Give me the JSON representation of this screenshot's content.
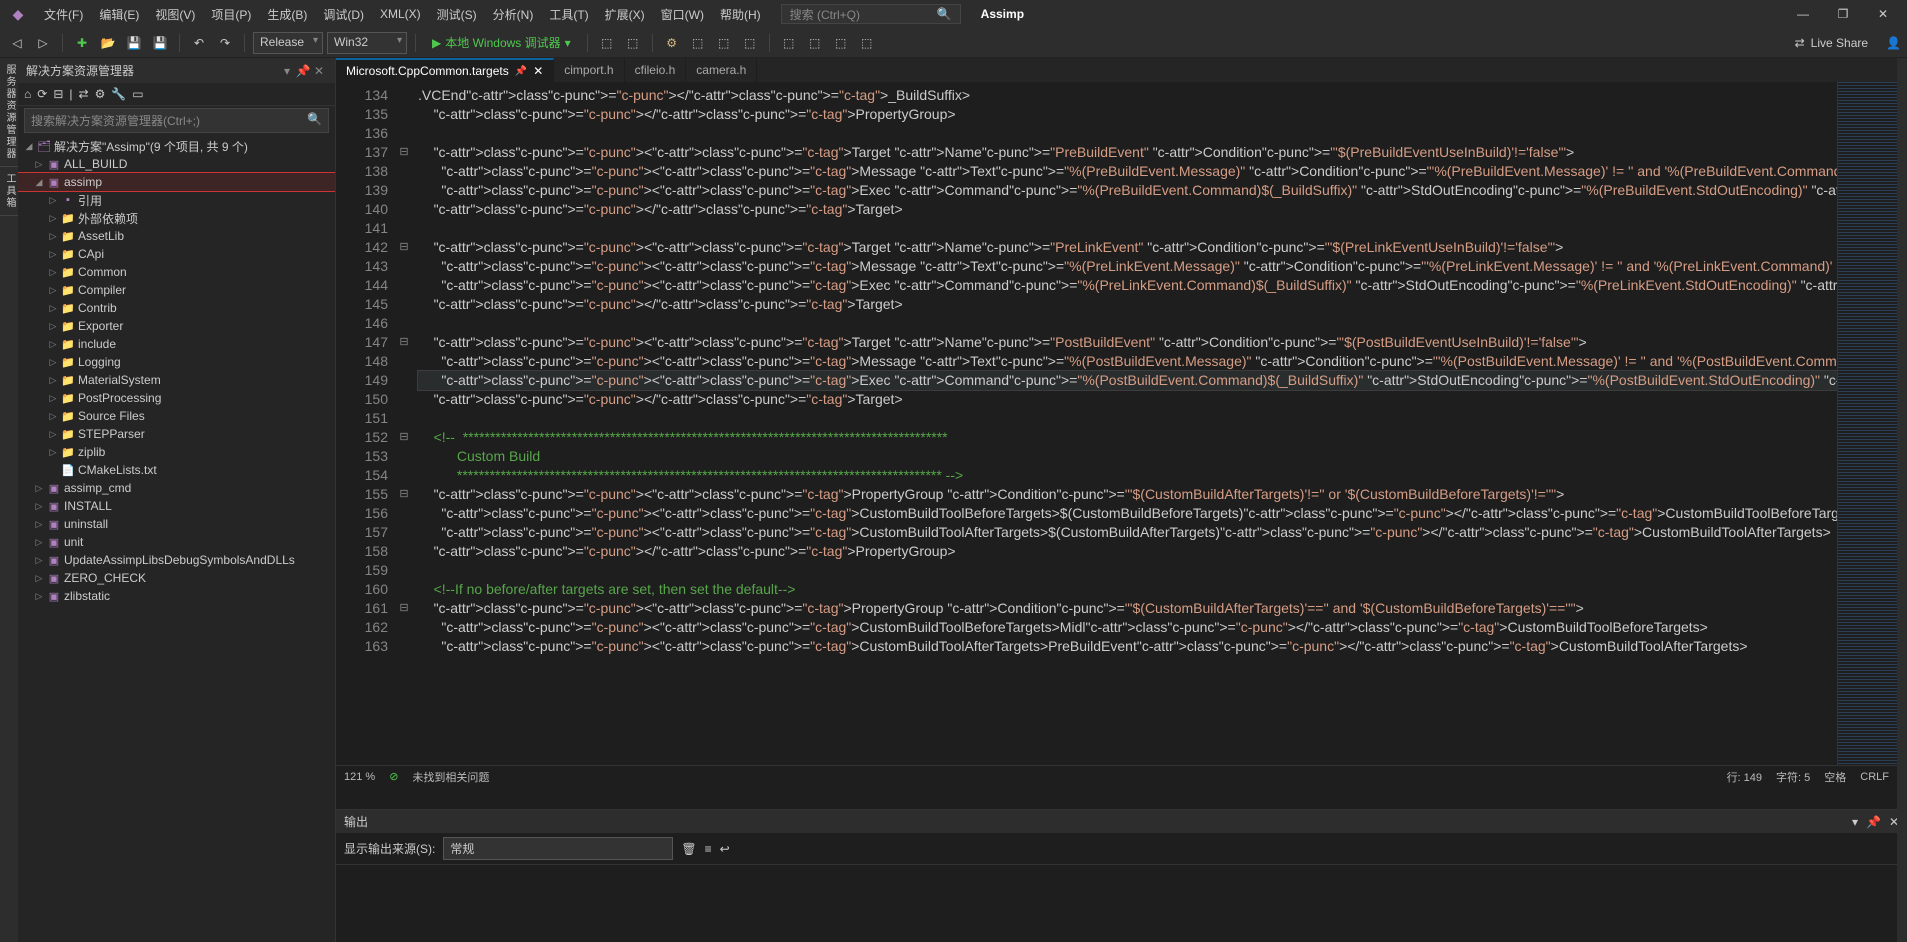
{
  "menu": {
    "items": [
      "文件(F)",
      "编辑(E)",
      "视图(V)",
      "项目(P)",
      "生成(B)",
      "调试(D)",
      "XML(X)",
      "测试(S)",
      "分析(N)",
      "工具(T)",
      "扩展(X)",
      "窗口(W)",
      "帮助(H)"
    ],
    "searchPlaceholder": "搜索 (Ctrl+Q)",
    "solutionName": "Assimp"
  },
  "toolbar": {
    "config": "Release",
    "platform": "Win32",
    "runLabel": "本地 Windows 调试器",
    "liveShare": "Live Share"
  },
  "sidebarTabs": [
    "服务器资源管理器",
    "工具箱"
  ],
  "explorer": {
    "title": "解决方案资源管理器",
    "searchPlaceholder": "搜索解决方案资源管理器(Ctrl+;)",
    "solutionLabel": "解决方案\"Assimp\"(9 个项目, 共 9 个)",
    "tree": [
      {
        "d": 1,
        "label": "ALL_BUILD",
        "icon": "▣",
        "arrow": "▷"
      },
      {
        "d": 1,
        "label": "assimp",
        "icon": "▣",
        "arrow": "◢",
        "selected": true
      },
      {
        "d": 2,
        "label": "引用",
        "icon": "▪",
        "arrow": "▷"
      },
      {
        "d": 2,
        "label": "外部依赖项",
        "icon": "📁",
        "arrow": "▷"
      },
      {
        "d": 2,
        "label": "AssetLib",
        "icon": "📁",
        "arrow": "▷"
      },
      {
        "d": 2,
        "label": "CApi",
        "icon": "📁",
        "arrow": "▷"
      },
      {
        "d": 2,
        "label": "Common",
        "icon": "📁",
        "arrow": "▷"
      },
      {
        "d": 2,
        "label": "Compiler",
        "icon": "📁",
        "arrow": "▷"
      },
      {
        "d": 2,
        "label": "Contrib",
        "icon": "📁",
        "arrow": "▷"
      },
      {
        "d": 2,
        "label": "Exporter",
        "icon": "📁",
        "arrow": "▷"
      },
      {
        "d": 2,
        "label": "include",
        "icon": "📁",
        "arrow": "▷"
      },
      {
        "d": 2,
        "label": "Logging",
        "icon": "📁",
        "arrow": "▷"
      },
      {
        "d": 2,
        "label": "MaterialSystem",
        "icon": "📁",
        "arrow": "▷"
      },
      {
        "d": 2,
        "label": "PostProcessing",
        "icon": "📁",
        "arrow": "▷"
      },
      {
        "d": 2,
        "label": "Source Files",
        "icon": "📁",
        "arrow": "▷"
      },
      {
        "d": 2,
        "label": "STEPParser",
        "icon": "📁",
        "arrow": "▷"
      },
      {
        "d": 2,
        "label": "ziplib",
        "icon": "📁",
        "arrow": "▷"
      },
      {
        "d": 2,
        "label": "CMakeLists.txt",
        "icon": "📄",
        "arrow": ""
      },
      {
        "d": 1,
        "label": "assimp_cmd",
        "icon": "▣",
        "arrow": "▷"
      },
      {
        "d": 1,
        "label": "INSTALL",
        "icon": "▣",
        "arrow": "▷"
      },
      {
        "d": 1,
        "label": "uninstall",
        "icon": "▣",
        "arrow": "▷"
      },
      {
        "d": 1,
        "label": "unit",
        "icon": "▣",
        "arrow": "▷"
      },
      {
        "d": 1,
        "label": "UpdateAssimpLibsDebugSymbolsAndDLLs",
        "icon": "▣",
        "arrow": "▷"
      },
      {
        "d": 1,
        "label": "ZERO_CHECK",
        "icon": "▣",
        "arrow": "▷"
      },
      {
        "d": 1,
        "label": "zlibstatic",
        "icon": "▣",
        "arrow": "▷"
      }
    ]
  },
  "tabs": [
    {
      "label": "Microsoft.CppCommon.targets",
      "active": true,
      "pinned": true
    },
    {
      "label": "cimport.h"
    },
    {
      "label": "cfileio.h"
    },
    {
      "label": "camera.h"
    }
  ],
  "code": {
    "startLine": 134,
    "currentLine": 149,
    "lines": [
      {
        "raw": ".VCEnd</_BuildSuffix>",
        "fold": ""
      },
      {
        "raw": "    </PropertyGroup>",
        "fold": ""
      },
      {
        "raw": "",
        "fold": ""
      },
      {
        "raw": "    <Target Name=\"PreBuildEvent\" Condition=\"'$(PreBuildEventUseInBuild)'!='false'\">",
        "fold": "⊟"
      },
      {
        "raw": "      <Message Text=\"%(PreBuildEvent.Message)\" Condition=\"'%(PreBuildEvent.Message)' != '' and '%(PreBuildEvent.Command)' != ''\"  Imp",
        "fold": ""
      },
      {
        "raw": "      <Exec Command=\"%(PreBuildEvent.Command)$(_BuildSuffix)\" StdOutEncoding=\"%(PreBuildEvent.StdOutEncoding)\" StdErrEncoding=\"%(PreB",
        "fold": ""
      },
      {
        "raw": "    </Target>",
        "fold": ""
      },
      {
        "raw": "",
        "fold": ""
      },
      {
        "raw": "    <Target Name=\"PreLinkEvent\" Condition=\"'$(PreLinkEventUseInBuild)'!='false'\">",
        "fold": "⊟"
      },
      {
        "raw": "      <Message Text=\"%(PreLinkEvent.Message)\" Condition=\"'%(PreLinkEvent.Message)' != '' and '%(PreLinkEvent.Command)' != ''\" Importa",
        "fold": ""
      },
      {
        "raw": "      <Exec Command=\"%(PreLinkEvent.Command)$(_BuildSuffix)\" StdOutEncoding=\"%(PreLinkEvent.StdOutEncoding)\" StdErrEncoding=\"%(PreLin",
        "fold": ""
      },
      {
        "raw": "    </Target>",
        "fold": ""
      },
      {
        "raw": "",
        "fold": ""
      },
      {
        "raw": "    <Target Name=\"PostBuildEvent\" Condition=\"'$(PostBuildEventUseInBuild)'!='false'\">",
        "fold": "⊟"
      },
      {
        "raw": "      <Message Text=\"%(PostBuildEvent.Message)\" Condition=\"'%(PostBuildEvent.Message)' != '' and '%(PostBuildEvent.Command)' != ''\"  I",
        "fold": ""
      },
      {
        "raw": "      <Exec Command=\"%(PostBuildEvent.Command)$(_BuildSuffix)\" StdOutEncoding=\"%(PostBuildEvent.StdOutEncoding)\" StdErrEncoding=\"%(Po",
        "fold": "",
        "cur": true
      },
      {
        "raw": "    </Target>",
        "fold": ""
      },
      {
        "raw": "",
        "fold": ""
      },
      {
        "raw": "    <!--  *****************************************************************************************",
        "fold": "⊟",
        "cmt": true
      },
      {
        "raw": "          Custom Build",
        "cmt": true,
        "fold": ""
      },
      {
        "raw": "          ***************************************************************************************** -->",
        "cmt": true,
        "fold": ""
      },
      {
        "raw": "    <PropertyGroup Condition=\"'$(CustomBuildAfterTargets)'!='' or '$(CustomBuildBeforeTargets)'!=''\">",
        "fold": "⊟"
      },
      {
        "raw": "      <CustomBuildToolBeforeTargets>$(CustomBuildBeforeTargets)</CustomBuildToolBeforeTargets>",
        "fold": ""
      },
      {
        "raw": "      <CustomBuildToolAfterTargets>$(CustomBuildAfterTargets)</CustomBuildToolAfterTargets>",
        "fold": ""
      },
      {
        "raw": "    </PropertyGroup>",
        "fold": ""
      },
      {
        "raw": "",
        "fold": ""
      },
      {
        "raw": "    <!--If no before/after targets are set, then set the default-->",
        "cmt": true,
        "fold": ""
      },
      {
        "raw": "    <PropertyGroup Condition=\"'$(CustomBuildAfterTargets)'=='' and '$(CustomBuildBeforeTargets)'==''\">",
        "fold": "⊟"
      },
      {
        "raw": "      <CustomBuildToolBeforeTargets>Midl</CustomBuildToolBeforeTargets>",
        "fold": ""
      },
      {
        "raw": "      <CustomBuildToolAfterTargets>PreBuildEvent</CustomBuildToolAfterTargets>",
        "fold": ""
      }
    ]
  },
  "status": {
    "zoom": "121 %",
    "issues": "未找到相关问题",
    "line": "行: 149",
    "col": "字符: 5",
    "ins": "空格",
    "enc": "CRLF"
  },
  "output": {
    "title": "输出",
    "sourceLabel": "显示输出来源(S):",
    "source": "常规"
  }
}
